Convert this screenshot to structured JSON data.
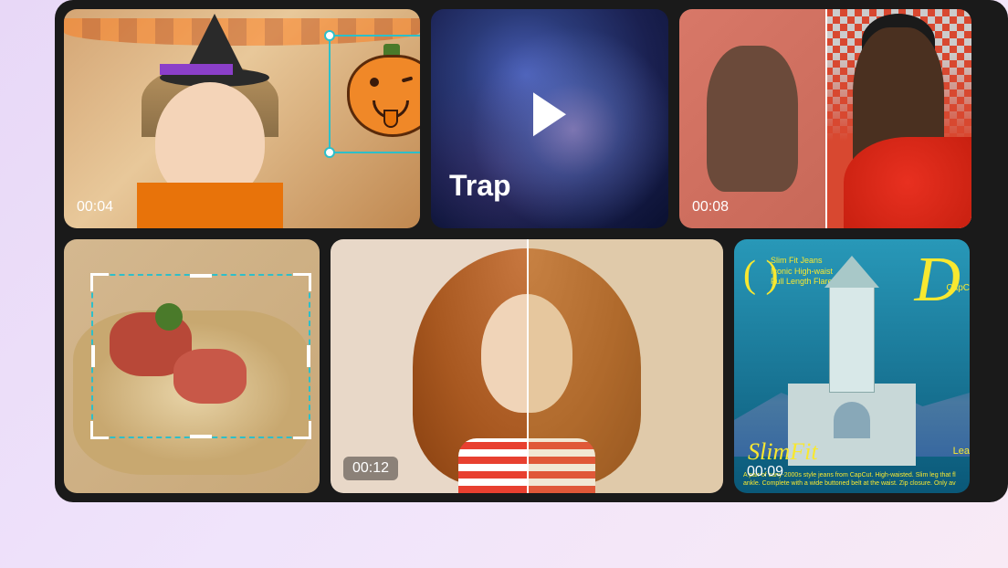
{
  "tiles": {
    "halloween": {
      "timestamp": "00:04",
      "sticker": "pumpkin-sticker"
    },
    "trap": {
      "label": "Trap"
    },
    "compare_models": {
      "timestamp": "00:08"
    },
    "food": {},
    "portrait": {
      "timestamp": "00:12"
    },
    "poster": {
      "timestamp": "00:09",
      "headline_lines": [
        "Slim Fit Jeans",
        "Iconic High-waist",
        "Full Length Flared"
      ],
      "letter": "D",
      "paren": "(     )",
      "brand": "CapC",
      "title": "SlimFit",
      "cta": "Lea",
      "description": "A pair of cany-2000s style jeans from CapCut. High-waisted. Slim leg that fl ankle. Complete with a wide buttoned belt at the waist. Zip closure. Only av"
    }
  }
}
